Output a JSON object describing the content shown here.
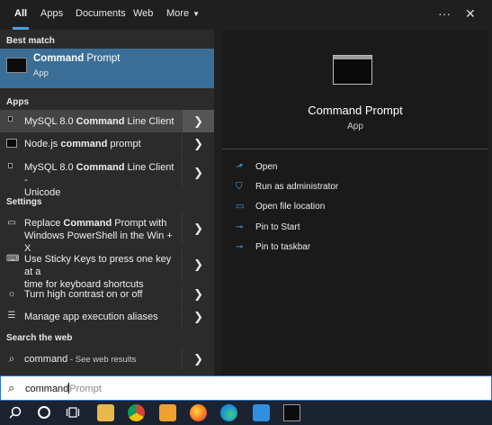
{
  "tabs": [
    {
      "label": "All"
    },
    {
      "label": "Apps"
    },
    {
      "label": "Documents"
    },
    {
      "label": "Web"
    },
    {
      "label": "More",
      "caret": "▼"
    }
  ],
  "top_icons": {
    "more": "···",
    "close": "✕"
  },
  "sections": {
    "best_match": "Best match",
    "apps": "Apps",
    "settings": "Settings",
    "web": "Search the web"
  },
  "best_match": {
    "title_bold": "Command",
    "title_rest": " Prompt",
    "subtitle": "App"
  },
  "apps": [
    {
      "pre": "MySQL 8.0 ",
      "bold": "Command",
      "post": " Line Client",
      "line2": ""
    },
    {
      "pre": "Node.js ",
      "bold": "command",
      "post": " prompt",
      "line2": ""
    },
    {
      "pre": "MySQL 8.0 ",
      "bold": "Command",
      "post": " Line Client -",
      "line2": "Unicode"
    }
  ],
  "settings": [
    {
      "pre": "Replace ",
      "bold": "Command",
      "post": " Prompt with",
      "line2": "Windows PowerShell in the Win + X"
    },
    {
      "pre": "Use Sticky Keys to press one key at a",
      "bold": "",
      "post": "",
      "line2": "time for keyboard shortcuts"
    },
    {
      "pre": "Turn high contrast on or off",
      "bold": "",
      "post": "",
      "line2": ""
    },
    {
      "pre": "Manage app execution aliases",
      "bold": "",
      "post": "",
      "line2": ""
    }
  ],
  "web": {
    "query": "command",
    "suffix": " - See web results"
  },
  "preview": {
    "title": "Command Prompt",
    "subtitle": "App",
    "actions": [
      {
        "label": "Open",
        "icon": "open-icon",
        "glyph": "⬏"
      },
      {
        "label": "Run as administrator",
        "icon": "shield-icon",
        "glyph": "⛉"
      },
      {
        "label": "Open file location",
        "icon": "folder-icon",
        "glyph": "▭"
      },
      {
        "label": "Pin to Start",
        "icon": "pin-icon",
        "glyph": "⊸"
      },
      {
        "label": "Pin to taskbar",
        "icon": "pin-icon",
        "glyph": "⊸"
      }
    ]
  },
  "search": {
    "typed": "command",
    "autocomplete": "Prompt"
  },
  "arrow_glyph": "❯",
  "colors": {
    "accent": "#4aa0e6",
    "best_match_bg": "#3b6e96",
    "selected_row": "#444444",
    "taskbar": "#1b2330"
  }
}
